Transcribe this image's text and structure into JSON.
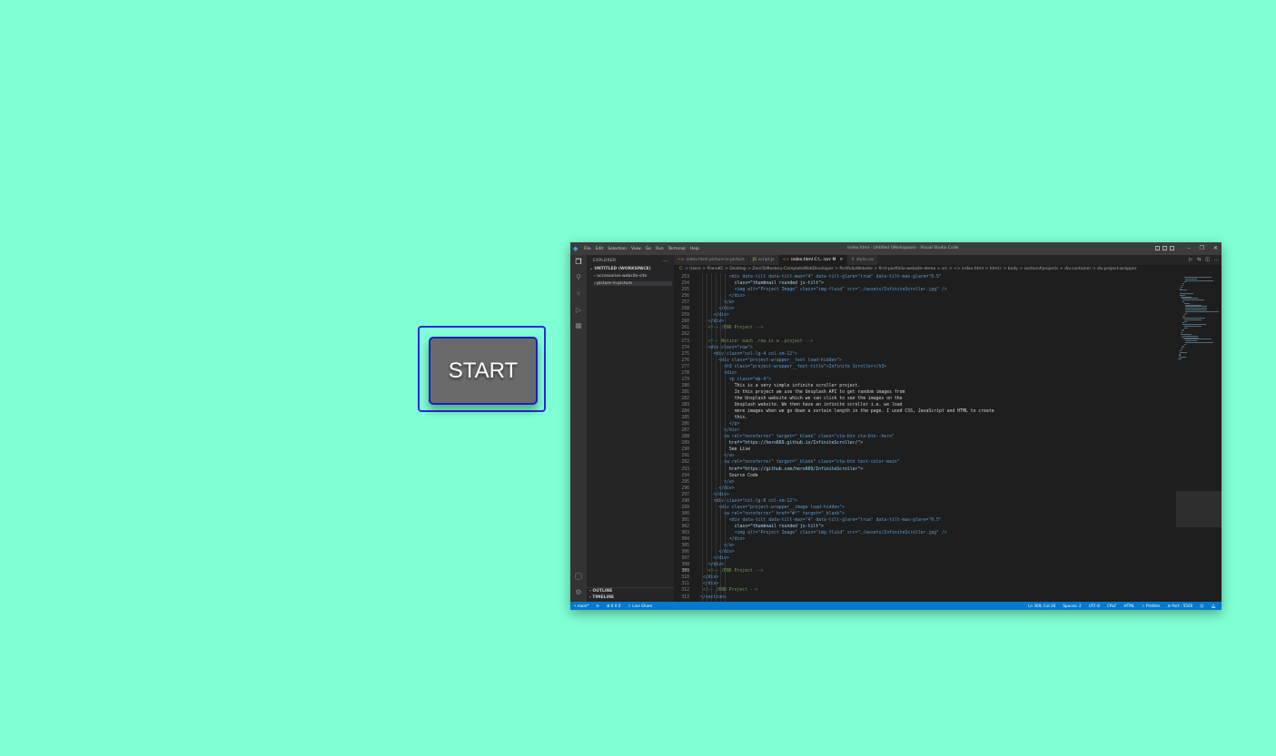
{
  "start_button": {
    "label": "START"
  },
  "vscode": {
    "title": "index.html - Untitled (Workspace) - Visual Studio Code",
    "menu": [
      "File",
      "Edit",
      "Selection",
      "View",
      "Go",
      "Run",
      "Terminal",
      "Help"
    ],
    "sidebar": {
      "header": "EXPLORER",
      "workspace": "UNTITLED (WORKSPACE)",
      "folders": [
        "accessories-website-site",
        "picture-in-picture"
      ],
      "outline": "OUTLINE",
      "timeline": "TIMELINE"
    },
    "tabs": [
      {
        "label": "index.html picture-in-picture",
        "icon": "html-icon"
      },
      {
        "label": "script.js",
        "icon": "js-icon"
      },
      {
        "label": "index.html C:\\...\\src M",
        "icon": "html-icon",
        "active": true
      },
      {
        "label": "style.css",
        "icon": "css-icon"
      }
    ],
    "breadcrumb": "C: > Users > PianoKC > Desktop > ZeroToMastery-CompleteWebDeveloper > PortfolioWebsite > first-portfolio-website-demo > src > <> index.html > html.r > body > section#projects > div.container > div.project-wrapper",
    "code_lines": [
      {
        "n": "253",
        "indent": 11,
        "text": "<div data-tilt data-tilt-max=\"4\" data-tilt-glare=\"true\" data-tilt-max-glare=\"0.5\""
      },
      {
        "n": "254",
        "indent": 13,
        "text": "class=\"thumbnail rounded js-tilt\">"
      },
      {
        "n": "255",
        "indent": 13,
        "text": "<img alt=\"Project Image\" class=\"img-fluid\" src=\"./assets/InfiniteScroller.jpg\" />"
      },
      {
        "n": "256",
        "indent": 11,
        "text": "</div>"
      },
      {
        "n": "257",
        "indent": 9,
        "text": "</a>"
      },
      {
        "n": "258",
        "indent": 7,
        "text": "</div>"
      },
      {
        "n": "259",
        "indent": 5,
        "text": "</div>"
      },
      {
        "n": "260",
        "indent": 3,
        "text": "</div>"
      },
      {
        "n": "261",
        "indent": 3,
        "text": "<!-- /END Project -->"
      },
      {
        "n": "262",
        "indent": 0,
        "text": ""
      },
      {
        "n": "273",
        "indent": 3,
        "text": "<!-- Notice: each .row is a .project -->"
      },
      {
        "n": "274",
        "indent": 3,
        "text": "<div class=\"row\">"
      },
      {
        "n": "275",
        "indent": 5,
        "text": "<div class=\"col-lg-4 col-sm-12\">"
      },
      {
        "n": "276",
        "indent": 7,
        "text": "<div class=\"project-wrapper__text load-hidden\">"
      },
      {
        "n": "277",
        "indent": 9,
        "text": "<h3 class=\"project-wrapper__text-title\">Infinite Scroller</h3>"
      },
      {
        "n": "278",
        "indent": 9,
        "text": "<div>"
      },
      {
        "n": "279",
        "indent": 11,
        "text": "<p class=\"mb-4\">"
      },
      {
        "n": "280",
        "indent": 13,
        "text": "This is a very simple infinite scroller project."
      },
      {
        "n": "281",
        "indent": 13,
        "text": "In this project we use the Unsplash API to get random images from"
      },
      {
        "n": "282",
        "indent": 13,
        "text": "the Unsplash website which we can click to see the images on the"
      },
      {
        "n": "283",
        "indent": 13,
        "text": "Unsplash website. We then have an infinite scroller i.e. we load"
      },
      {
        "n": "284",
        "indent": 13,
        "text": "more images when we go down a certain length in the page. I used CSS, JavaScript and HTML to create"
      },
      {
        "n": "285",
        "indent": 13,
        "text": "this."
      },
      {
        "n": "286",
        "indent": 11,
        "text": "</p>"
      },
      {
        "n": "287",
        "indent": 9,
        "text": "</div>"
      },
      {
        "n": "288",
        "indent": 9,
        "text": "<a rel=\"noreferrer\" target=\"_blank\" class=\"cta-btn cta-btn--hero\""
      },
      {
        "n": "289",
        "indent": 11,
        "text": "href=\"https://hero669.github.io/InfiniteScroller/\">"
      },
      {
        "n": "290",
        "indent": 11,
        "text": "See Live"
      },
      {
        "n": "291",
        "indent": 9,
        "text": "</a>"
      },
      {
        "n": "292",
        "indent": 9,
        "text": "<a rel=\"noreferrer\" target=\"_blank\" class=\"cta-btn text-color-main\""
      },
      {
        "n": "293",
        "indent": 11,
        "text": "href=\"https://github.com/hero669/InfiniteScroller\">"
      },
      {
        "n": "294",
        "indent": 11,
        "text": "Source Code"
      },
      {
        "n": "295",
        "indent": 9,
        "text": "</a>"
      },
      {
        "n": "296",
        "indent": 7,
        "text": "</div>"
      },
      {
        "n": "297",
        "indent": 5,
        "text": "</div>"
      },
      {
        "n": "298",
        "indent": 5,
        "text": "<div class=\"col-lg-8 col-sm-12\">"
      },
      {
        "n": "299",
        "indent": 7,
        "text": "<div class=\"project-wrapper__image load-hidden\">"
      },
      {
        "n": "300",
        "indent": 9,
        "text": "<a rel=\"noreferrer\" href=\"#!\" target=\"_blank\">"
      },
      {
        "n": "301",
        "indent": 11,
        "text": "<div data-tilt data-tilt-max=\"4\" data-tilt-glare=\"true\" data-tilt-max-glare=\"0.5\""
      },
      {
        "n": "302",
        "indent": 13,
        "text": "class=\"thumbnail rounded js-tilt\">"
      },
      {
        "n": "303",
        "indent": 13,
        "text": "<img alt=\"Project Image\" class=\"img-fluid\" src=\"./assets/InfiniteScroller.jpg\" />"
      },
      {
        "n": "304",
        "indent": 11,
        "text": "</div>"
      },
      {
        "n": "305",
        "indent": 9,
        "text": "</a>"
      },
      {
        "n": "306",
        "indent": 7,
        "text": "</div>"
      },
      {
        "n": "307",
        "indent": 5,
        "text": "</div>"
      },
      {
        "n": "308",
        "indent": 3,
        "text": "</div>"
      },
      {
        "n": "309",
        "indent": 3,
        "text": "<!-- /END Project -->",
        "current": true
      },
      {
        "n": "310",
        "indent": 1,
        "text": "</div>"
      },
      {
        "n": "311",
        "indent": 1,
        "text": "</div>"
      },
      {
        "n": "312",
        "indent": 1,
        "text": "<!-- /END Project -->"
      },
      {
        "n": "313",
        "indent": 0,
        "text": "</section>"
      }
    ],
    "status": {
      "branch": "main*",
      "errors": "0 0 0",
      "live_share": "Live Share",
      "position": "Ln 309, Col 26",
      "spaces": "Spaces: 2",
      "encoding": "UTF-8",
      "eol": "CRLF",
      "language": "HTML",
      "prettier": "Prettier",
      "port": "Port : 5500"
    },
    "colors": {
      "statusbar": "#007acc",
      "background": "#1e1e1e",
      "page": "#7fffd4"
    }
  }
}
